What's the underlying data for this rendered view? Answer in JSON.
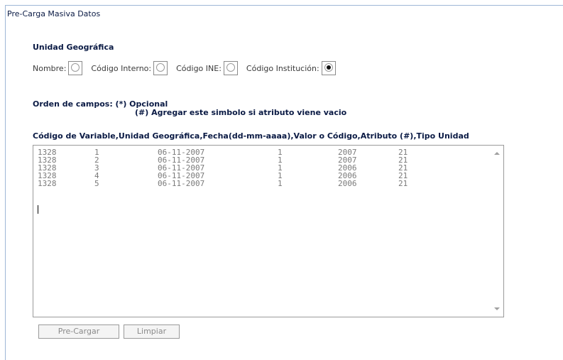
{
  "page": {
    "title": "Pre-Carga Masiva Datos"
  },
  "unidad": {
    "label": "Unidad Geográfica",
    "options": [
      {
        "label": "Nombre:",
        "checked": false
      },
      {
        "label": "Código Interno:",
        "checked": false
      },
      {
        "label": "Código INE:",
        "checked": false
      },
      {
        "label": "Código Institución:",
        "checked": true
      }
    ]
  },
  "order": {
    "line1": "Orden de campos: (*) Opcional",
    "line2": "(#) Agregar este simbolo si atributo viene vacio"
  },
  "fields_header": "Código de Variable,Unidad Geográfica,Fecha(dd-mm-aaaa),Valor o Código,Atributo (#),Tipo Unidad",
  "textarea": {
    "rows": [
      [
        "1328",
        "1",
        "06-11-2007",
        "1",
        "2007",
        "21"
      ],
      [
        "1328",
        "2",
        "06-11-2007",
        "1",
        "2007",
        "21"
      ],
      [
        "1328",
        "3",
        "06-11-2007",
        "1",
        "2006",
        "21"
      ],
      [
        "1328",
        "4",
        "06-11-2007",
        "1",
        "2006",
        "21"
      ],
      [
        "1328",
        "5",
        "06-11-2007",
        "1",
        "2006",
        "21"
      ]
    ]
  },
  "buttons": {
    "precargar": "Pre-Cargar",
    "limpiar": "Limpiar"
  }
}
